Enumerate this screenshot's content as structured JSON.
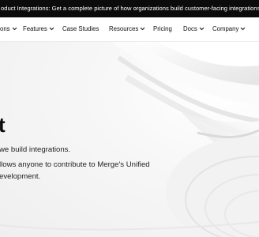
{
  "banner": {
    "text": "oduct Integrations: Get a complete picture of how organizations build customer-facing integrations"
  },
  "nav": {
    "items": [
      {
        "label": "ons",
        "has_dropdown": true
      },
      {
        "label": "Features",
        "has_dropdown": true
      },
      {
        "label": "Case Studies",
        "has_dropdown": false
      },
      {
        "label": "Resources",
        "has_dropdown": true
      },
      {
        "label": "Pricing",
        "has_dropdown": false
      },
      {
        "label": "Docs",
        "has_dropdown": true
      },
      {
        "label": "Company",
        "has_dropdown": true
      }
    ]
  },
  "hero": {
    "title": "t",
    "line1": "we build integrations.",
    "line2": "llows anyone to contribute to Merge's Unified",
    "line3": "evelopment."
  },
  "colors": {
    "banner_bg": "#0b0b0b",
    "nav_bg": "#ffffff",
    "hero_bg": "#f3f3f3"
  }
}
